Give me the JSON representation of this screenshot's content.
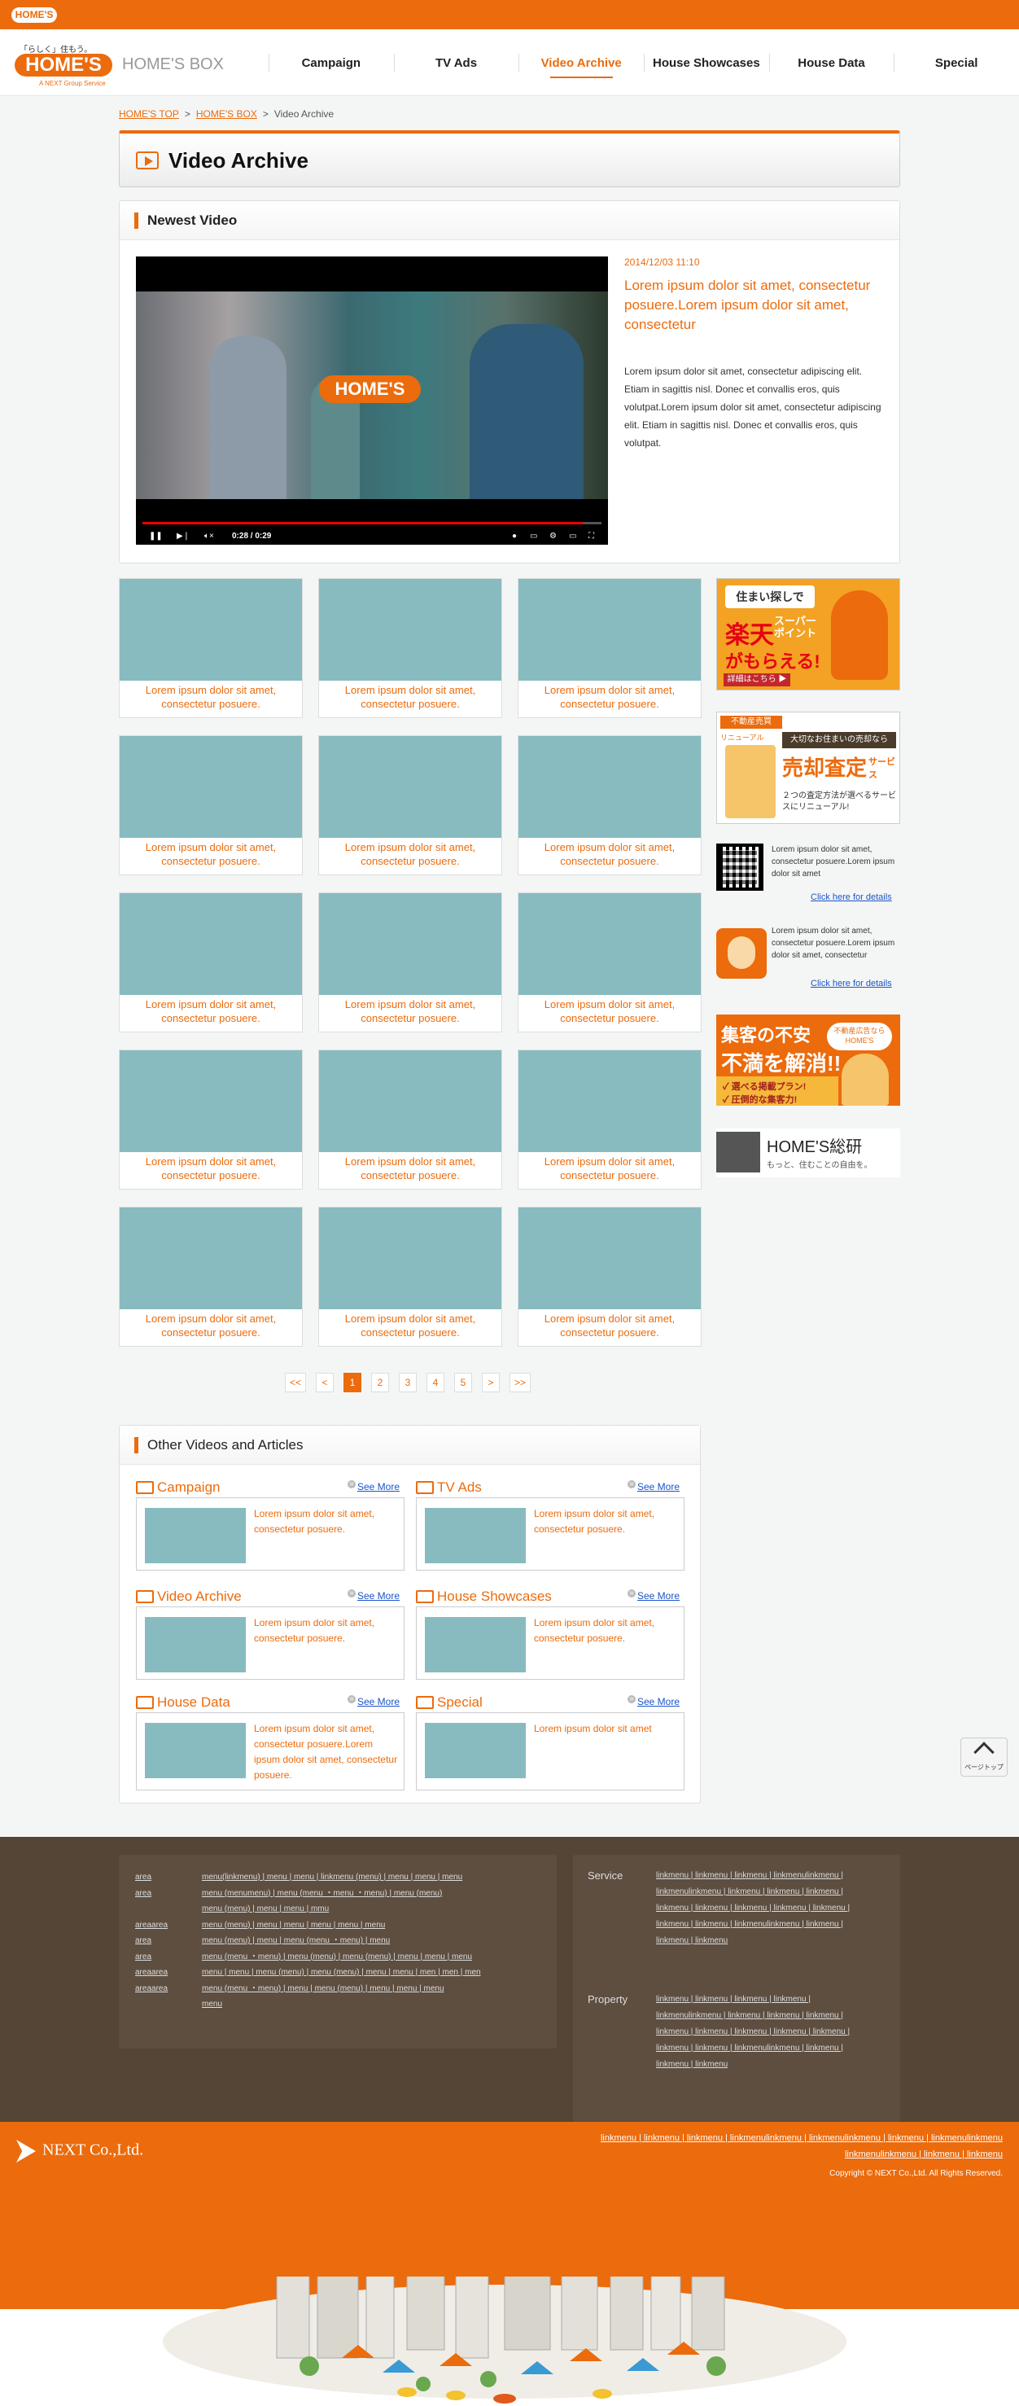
{
  "topbar": {
    "mini_logo": "HOME'S"
  },
  "header": {
    "logo_tagline": "「らしく」住もう。",
    "logo_text": "HOME'S",
    "logo_sub": "A NEXT Group Service",
    "site_name": "HOME'S BOX",
    "nav": [
      "Campaign",
      "TV Ads",
      "Video Archive",
      "House Showcases",
      "House Data",
      "Special"
    ],
    "active_nav": "Video Archive"
  },
  "breadcrumb": {
    "items": [
      "HOME'S TOP",
      "HOME'S BOX",
      "Video Archive"
    ],
    "separator": ">"
  },
  "page_title": "Video Archive",
  "newest": {
    "heading": "Newest Video",
    "date": "2014/12/03 11:10",
    "title": "Lorem ipsum dolor sit amet, consectetur posuere.Lorem ipsum dolor sit amet, consectetur",
    "description": "Lorem ipsum dolor sit amet, consectetur adipiscing elit. Etiam in sagittis nisl. Donec et convallis eros, quis volutpat.Lorem ipsum dolor sit amet, consectetur adipiscing elit. Etiam in sagittis nisl. Donec et convallis eros, quis volutpat.",
    "player": {
      "time": "0:28 / 0:29",
      "progress": 0.96,
      "overlay_logo": "HOME'S"
    }
  },
  "grid": {
    "caption": "Lorem ipsum dolor sit amet, consectetur posuere.",
    "rows": 5,
    "cols": 3
  },
  "sidebar": {
    "ad1": {
      "box": "住まい探しで",
      "big": "楽天",
      "s1": "スーパー",
      "s1b": "ポイント",
      "s2": "がもらえる!",
      "btn": "詳細はこちら ▶"
    },
    "ad2": {
      "tag": "不動産売買",
      "dark": "大切なお住まいの売却なら",
      "big": "売却査定",
      "svc": "サービス",
      "renewal": "リニューアル",
      "txt": "２つの査定方法が選べるサービスにリニューアル!"
    },
    "qr_text": "Lorem ipsum dolor sit amet, consectetur posuere.Lorem ipsum dolor sit amet",
    "app_text": "Lorem ipsum dolor sit amet, consectetur posuere.Lorem ipsum dolor sit amet, consectetur",
    "details_link": "Click here for details",
    "ad3": {
      "l1": "集客の不安",
      "l2": "不満を解消!!",
      "b1": "✓ 選べる掲載プラン!",
      "b2": "✓ 圧倒的な集客力!",
      "r": "不動産広告なら HOME'S"
    },
    "ad4": {
      "title": "HOME'S総研",
      "sub": "もっと、住むことの自由を。"
    }
  },
  "pagination": [
    "<<",
    "<",
    "1",
    "2",
    "3",
    "4",
    "5",
    ">",
    ">>"
  ],
  "pagination_current": "1",
  "other": {
    "heading": "Other Videos and Articles",
    "see_more": "See More",
    "sections": [
      {
        "title": "Campaign",
        "text": "Lorem ipsum dolor sit amet, consectetur posuere."
      },
      {
        "title": "TV Ads",
        "text": "Lorem ipsum dolor sit amet, consectetur posuere."
      },
      {
        "title": "Video Archive",
        "text": "Lorem ipsum dolor sit amet, consectetur posuere."
      },
      {
        "title": "House Showcases",
        "text": "Lorem ipsum dolor sit amet, consectetur posuere."
      },
      {
        "title": "House Data",
        "text": "Lorem ipsum dolor sit amet, consectetur posuere.Lorem ipsum dolor sit amet, consectetur posuere."
      },
      {
        "title": "Special",
        "text": "Lorem ipsum dolor sit amet"
      }
    ]
  },
  "pagetop": {
    "label": "ページトップ"
  },
  "footer": {
    "rows": [
      {
        "k": "area",
        "v": "menu(linkmenu) | menu | menu | linkmenu (menu) | menu | menu | menu"
      },
      {
        "k": "area",
        "v": "menu (menumenu) | menu (menu ・menu ・menu) | menu (menu)"
      },
      {
        "k": "",
        "v": "menu (menu) | menu | menu | mmu"
      },
      {
        "k": "areaarea",
        "v": "menu (menu) | menu | menu | menu | menu | menu"
      },
      {
        "k": "area",
        "v": "menu (menu) | menu | menu (menu ・menu) | menu"
      },
      {
        "k": "area",
        "v": "menu (menu ・menu) | menu (menu) | menu (menu) | menu | menu | menu"
      },
      {
        "k": "areaarea",
        "v": "menu | menu | menu (menu) | menu (menu) | menu | menu | men | men | men"
      },
      {
        "k": "areaarea",
        "v": "menu (menu ・menu) | menu | menu (menu) | menu | menu | menu"
      },
      {
        "k": "",
        "v": "menu"
      }
    ],
    "service_head": "Service",
    "service_links": "linkmenu | linkmenu | linkmenu | linkmenulinkmenu | linkmenulinkmenu | linkmenu | linkmenu | linkmenu | linkmenu | linkmenu | linkmenu | linkmenu | linkmenu | linkmenu | linkmenu | linkmenulinkmenu | linkmenu | linkmenu | linkmenu",
    "property_head": "Property",
    "property_links": "linkmenu | linkmenu | linkmenu | linkmenu | linkmenulinkmenu | linkmenu | linkmenu | linkmenu | linkmenu | linkmenu | linkmenu | linkmenu | linkmenu | linkmenu | linkmenu | linkmenulinkmenu | linkmenu | linkmenu | linkmenu",
    "company": "NEXT Co.,Ltd.",
    "bottom_links_1": "linkmenu | linkmenu | linkmenu | linkmenulinkmenu | linkmenulinkmenu | linkmenu | linkmenulinkmenu",
    "bottom_links_2": "linkmenulinkmenu | linkmenu | linkmenu",
    "copyright": "Copyright © NEXT Co.,Ltd. All Rights Reserved."
  }
}
